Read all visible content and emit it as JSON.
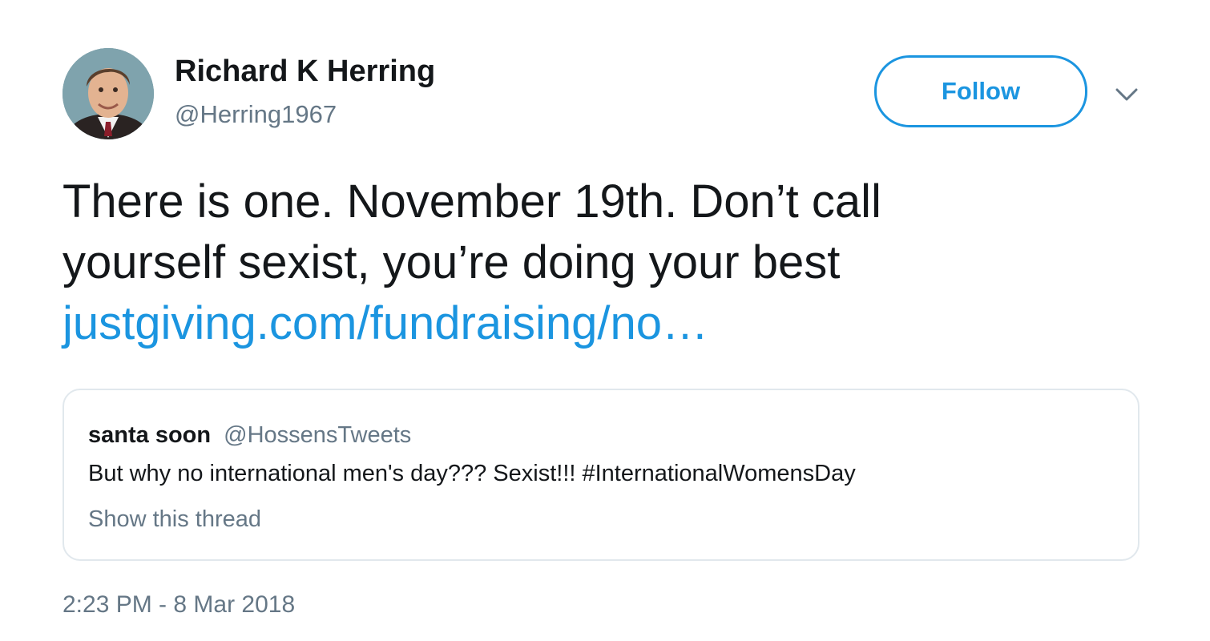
{
  "author": {
    "display_name": "Richard K Herring",
    "handle": "@Herring1967",
    "avatar_icon": "profile-photo"
  },
  "actions": {
    "follow_label": "Follow",
    "menu_icon": "chevron-down-icon"
  },
  "tweet": {
    "line1": "There is one. November 19th. Don’t call",
    "line2": "yourself sexist, you’re doing your best",
    "link_text": "justgiving.com/fundraising/no…"
  },
  "quoted_tweet": {
    "name": "santa soon",
    "handle": "@HossensTweets",
    "text": "But why no international men's day??? Sexist!!! #InternationalWomensDay",
    "show_thread": "Show this thread"
  },
  "timestamp": "2:23 PM - 8 Mar 2018",
  "colors": {
    "link": "#1b95e0",
    "secondary_text": "#657786",
    "border": "#e1e8ed",
    "primary_text": "#14171a"
  }
}
